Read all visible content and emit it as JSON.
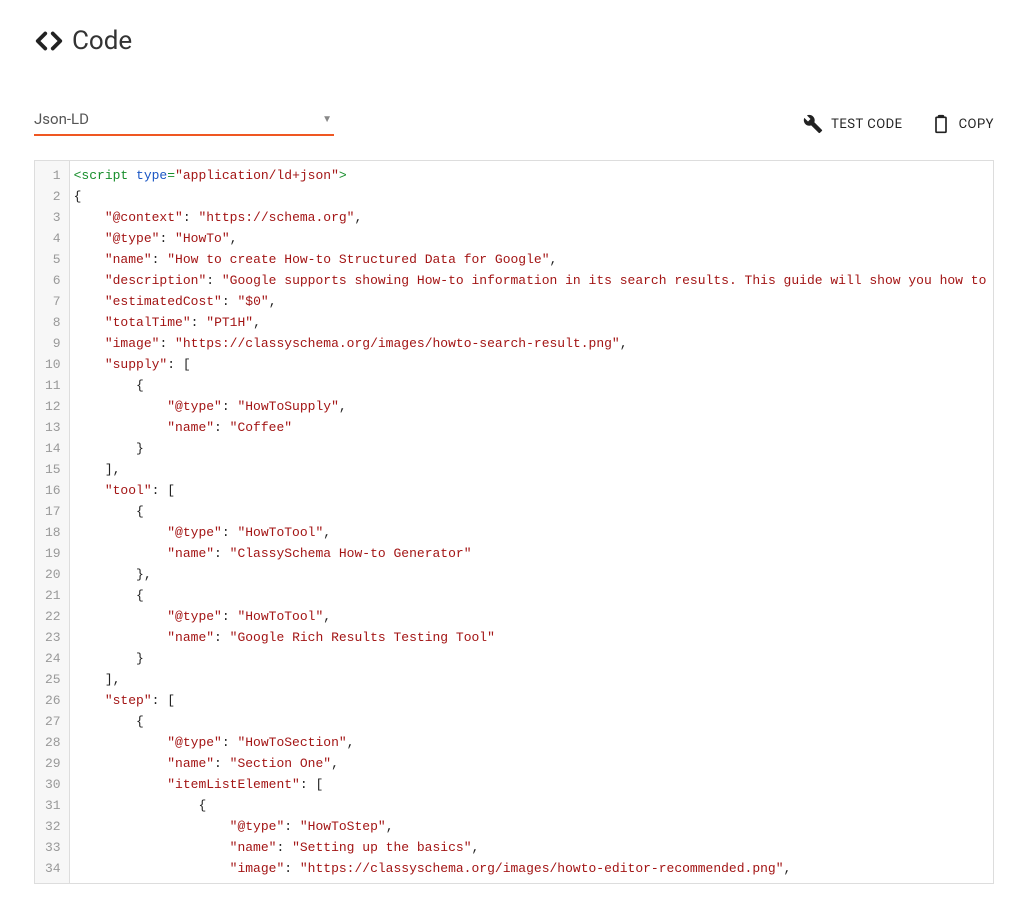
{
  "header": {
    "title": "Code"
  },
  "select": {
    "value": "Json-LD"
  },
  "actions": {
    "test": "TEST CODE",
    "copy": "COPY"
  },
  "code": {
    "lines": [
      [
        {
          "c": "t-tag",
          "t": "<script "
        },
        {
          "c": "t-attr",
          "t": "type"
        },
        {
          "c": "t-tag",
          "t": "="
        },
        {
          "c": "t-str",
          "t": "\"application/ld+json\""
        },
        {
          "c": "t-tag",
          "t": ">"
        }
      ],
      [
        {
          "c": "t-punc",
          "t": "{"
        }
      ],
      [
        {
          "c": "",
          "t": "    "
        },
        {
          "c": "t-key",
          "t": "\"@context\""
        },
        {
          "c": "t-punc",
          "t": ": "
        },
        {
          "c": "t-str",
          "t": "\"https://schema.org\""
        },
        {
          "c": "t-punc",
          "t": ","
        }
      ],
      [
        {
          "c": "",
          "t": "    "
        },
        {
          "c": "t-key",
          "t": "\"@type\""
        },
        {
          "c": "t-punc",
          "t": ": "
        },
        {
          "c": "t-str",
          "t": "\"HowTo\""
        },
        {
          "c": "t-punc",
          "t": ","
        }
      ],
      [
        {
          "c": "",
          "t": "    "
        },
        {
          "c": "t-key",
          "t": "\"name\""
        },
        {
          "c": "t-punc",
          "t": ": "
        },
        {
          "c": "t-str",
          "t": "\"How to create How-to Structured Data for Google\""
        },
        {
          "c": "t-punc",
          "t": ","
        }
      ],
      [
        {
          "c": "",
          "t": "    "
        },
        {
          "c": "t-key",
          "t": "\"description\""
        },
        {
          "c": "t-punc",
          "t": ": "
        },
        {
          "c": "t-str",
          "t": "\"Google supports showing How-to information in its search results. This guide will show you how to use "
        }
      ],
      [
        {
          "c": "",
          "t": "    "
        },
        {
          "c": "t-key",
          "t": "\"estimatedCost\""
        },
        {
          "c": "t-punc",
          "t": ": "
        },
        {
          "c": "t-str",
          "t": "\"$0\""
        },
        {
          "c": "t-punc",
          "t": ","
        }
      ],
      [
        {
          "c": "",
          "t": "    "
        },
        {
          "c": "t-key",
          "t": "\"totalTime\""
        },
        {
          "c": "t-punc",
          "t": ": "
        },
        {
          "c": "t-str",
          "t": "\"PT1H\""
        },
        {
          "c": "t-punc",
          "t": ","
        }
      ],
      [
        {
          "c": "",
          "t": "    "
        },
        {
          "c": "t-key",
          "t": "\"image\""
        },
        {
          "c": "t-punc",
          "t": ": "
        },
        {
          "c": "t-str",
          "t": "\"https://classyschema.org/images/howto-search-result.png\""
        },
        {
          "c": "t-punc",
          "t": ","
        }
      ],
      [
        {
          "c": "",
          "t": "    "
        },
        {
          "c": "t-key",
          "t": "\"supply\""
        },
        {
          "c": "t-punc",
          "t": ": ["
        }
      ],
      [
        {
          "c": "",
          "t": "        "
        },
        {
          "c": "t-punc",
          "t": "{"
        }
      ],
      [
        {
          "c": "",
          "t": "            "
        },
        {
          "c": "t-key",
          "t": "\"@type\""
        },
        {
          "c": "t-punc",
          "t": ": "
        },
        {
          "c": "t-str",
          "t": "\"HowToSupply\""
        },
        {
          "c": "t-punc",
          "t": ","
        }
      ],
      [
        {
          "c": "",
          "t": "            "
        },
        {
          "c": "t-key",
          "t": "\"name\""
        },
        {
          "c": "t-punc",
          "t": ": "
        },
        {
          "c": "t-str",
          "t": "\"Coffee\""
        }
      ],
      [
        {
          "c": "",
          "t": "        "
        },
        {
          "c": "t-punc",
          "t": "}"
        }
      ],
      [
        {
          "c": "",
          "t": "    "
        },
        {
          "c": "t-punc",
          "t": "],"
        }
      ],
      [
        {
          "c": "",
          "t": "    "
        },
        {
          "c": "t-key",
          "t": "\"tool\""
        },
        {
          "c": "t-punc",
          "t": ": ["
        }
      ],
      [
        {
          "c": "",
          "t": "        "
        },
        {
          "c": "t-punc",
          "t": "{"
        }
      ],
      [
        {
          "c": "",
          "t": "            "
        },
        {
          "c": "t-key",
          "t": "\"@type\""
        },
        {
          "c": "t-punc",
          "t": ": "
        },
        {
          "c": "t-str",
          "t": "\"HowToTool\""
        },
        {
          "c": "t-punc",
          "t": ","
        }
      ],
      [
        {
          "c": "",
          "t": "            "
        },
        {
          "c": "t-key",
          "t": "\"name\""
        },
        {
          "c": "t-punc",
          "t": ": "
        },
        {
          "c": "t-str",
          "t": "\"ClassySchema How-to Generator\""
        }
      ],
      [
        {
          "c": "",
          "t": "        "
        },
        {
          "c": "t-punc",
          "t": "},"
        }
      ],
      [
        {
          "c": "",
          "t": "        "
        },
        {
          "c": "t-punc",
          "t": "{"
        }
      ],
      [
        {
          "c": "",
          "t": "            "
        },
        {
          "c": "t-key",
          "t": "\"@type\""
        },
        {
          "c": "t-punc",
          "t": ": "
        },
        {
          "c": "t-str",
          "t": "\"HowToTool\""
        },
        {
          "c": "t-punc",
          "t": ","
        }
      ],
      [
        {
          "c": "",
          "t": "            "
        },
        {
          "c": "t-key",
          "t": "\"name\""
        },
        {
          "c": "t-punc",
          "t": ": "
        },
        {
          "c": "t-str",
          "t": "\"Google Rich Results Testing Tool\""
        }
      ],
      [
        {
          "c": "",
          "t": "        "
        },
        {
          "c": "t-punc",
          "t": "}"
        }
      ],
      [
        {
          "c": "",
          "t": "    "
        },
        {
          "c": "t-punc",
          "t": "],"
        }
      ],
      [
        {
          "c": "",
          "t": "    "
        },
        {
          "c": "t-key",
          "t": "\"step\""
        },
        {
          "c": "t-punc",
          "t": ": ["
        }
      ],
      [
        {
          "c": "",
          "t": "        "
        },
        {
          "c": "t-punc",
          "t": "{"
        }
      ],
      [
        {
          "c": "",
          "t": "            "
        },
        {
          "c": "t-key",
          "t": "\"@type\""
        },
        {
          "c": "t-punc",
          "t": ": "
        },
        {
          "c": "t-str",
          "t": "\"HowToSection\""
        },
        {
          "c": "t-punc",
          "t": ","
        }
      ],
      [
        {
          "c": "",
          "t": "            "
        },
        {
          "c": "t-key",
          "t": "\"name\""
        },
        {
          "c": "t-punc",
          "t": ": "
        },
        {
          "c": "t-str",
          "t": "\"Section One\""
        },
        {
          "c": "t-punc",
          "t": ","
        }
      ],
      [
        {
          "c": "",
          "t": "            "
        },
        {
          "c": "t-key",
          "t": "\"itemListElement\""
        },
        {
          "c": "t-punc",
          "t": ": ["
        }
      ],
      [
        {
          "c": "",
          "t": "                "
        },
        {
          "c": "t-punc",
          "t": "{"
        }
      ],
      [
        {
          "c": "",
          "t": "                    "
        },
        {
          "c": "t-key",
          "t": "\"@type\""
        },
        {
          "c": "t-punc",
          "t": ": "
        },
        {
          "c": "t-str",
          "t": "\"HowToStep\""
        },
        {
          "c": "t-punc",
          "t": ","
        }
      ],
      [
        {
          "c": "",
          "t": "                    "
        },
        {
          "c": "t-key",
          "t": "\"name\""
        },
        {
          "c": "t-punc",
          "t": ": "
        },
        {
          "c": "t-str",
          "t": "\"Setting up the basics\""
        },
        {
          "c": "t-punc",
          "t": ","
        }
      ],
      [
        {
          "c": "",
          "t": "                    "
        },
        {
          "c": "t-key",
          "t": "\"image\""
        },
        {
          "c": "t-punc",
          "t": ": "
        },
        {
          "c": "t-str",
          "t": "\"https://classyschema.org/images/howto-editor-recommended.png\""
        },
        {
          "c": "t-punc",
          "t": ","
        }
      ]
    ]
  }
}
